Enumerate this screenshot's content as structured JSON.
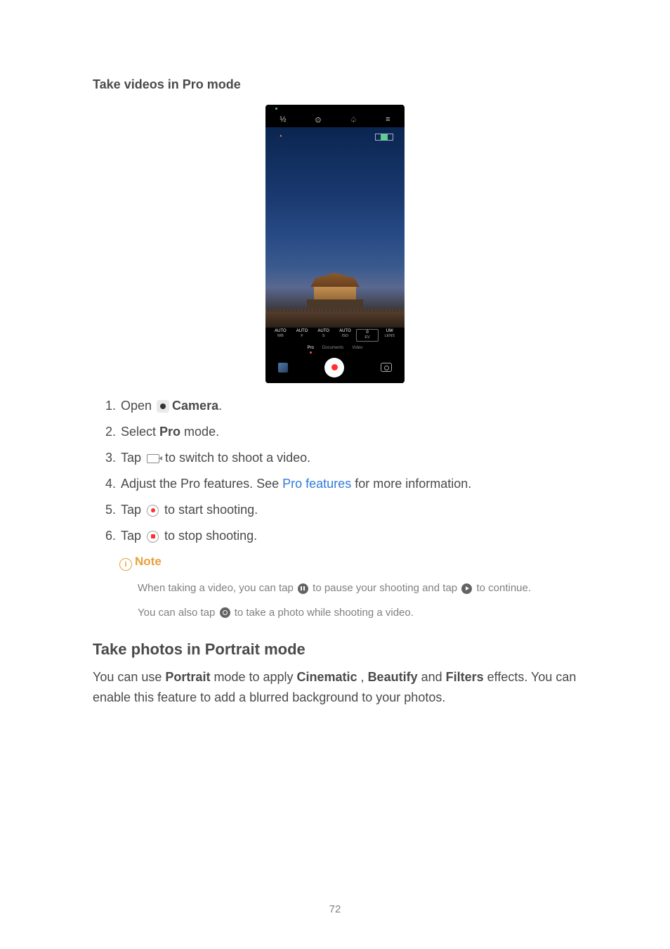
{
  "section1": {
    "title": "Take videos in Pro mode"
  },
  "phone": {
    "top_icons": [
      "½",
      "⊙",
      "♤",
      "≡"
    ],
    "pro": [
      {
        "top": "AUTO",
        "bottom": "WB",
        "sel": false
      },
      {
        "top": "AUTO",
        "bottom": "F",
        "sel": false
      },
      {
        "top": "AUTO",
        "bottom": "S",
        "sel": false
      },
      {
        "top": "AUTO",
        "bottom": "ISO",
        "sel": false
      },
      {
        "top": "0",
        "bottom": "EV",
        "sel": true
      },
      {
        "top": "UW",
        "bottom": "LENS",
        "sel": false
      }
    ],
    "modes": [
      {
        "label": "Pro",
        "active": true
      },
      {
        "label": "Documents",
        "active": false
      },
      {
        "label": "Video",
        "active": false
      }
    ]
  },
  "steps": {
    "s1_a": "Open ",
    "s1_b": "Camera",
    "s1_c": ".",
    "s2_a": "Select ",
    "s2_b": "Pro",
    "s2_c": " mode.",
    "s3_a": "Tap ",
    "s3_b": " to switch to shoot a video.",
    "s4_a": "Adjust the Pro features. See ",
    "s4_link": "Pro features",
    "s4_b": " for more information.",
    "s5_a": "Tap ",
    "s5_b": " to start shooting.",
    "s6_a": "Tap ",
    "s6_b": " to stop shooting."
  },
  "note": {
    "head": "Note",
    "p1_a": "When taking a video, you can tap ",
    "p1_b": " to pause your shooting and tap ",
    "p1_c": " to continue.",
    "p2_a": "You can also tap ",
    "p2_b": " to take a photo while shooting a video."
  },
  "section2": {
    "title": "Take photos in Portrait mode",
    "para_a": "You can use ",
    "b1": "Portrait",
    "para_b": " mode to apply ",
    "b2": "Cinematic",
    "para_c": " , ",
    "b3": "Beautify",
    "para_d": " and ",
    "b4": "Filters",
    "para_e": " effects. You can enable this feature to add a blurred background to your photos."
  },
  "pagenum": "72"
}
